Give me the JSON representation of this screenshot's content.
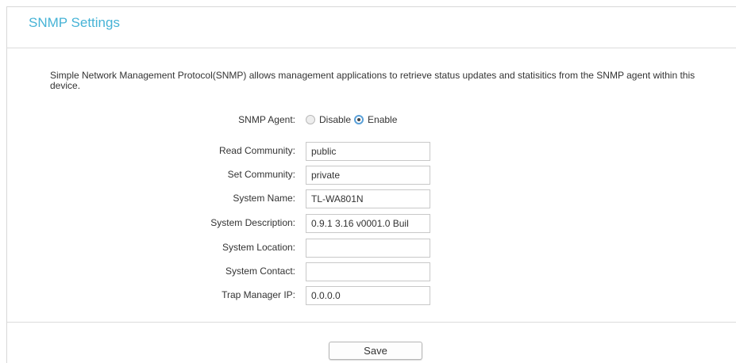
{
  "page": {
    "title": "SNMP Settings",
    "description": "Simple Network Management Protocol(SNMP) allows management applications to retrieve status updates and statisitics from the SNMP agent within this device."
  },
  "snmp_agent": {
    "label": "SNMP Agent:",
    "options": [
      {
        "label": "Disable",
        "checked": false
      },
      {
        "label": "Enable",
        "checked": true
      }
    ]
  },
  "fields": {
    "read_community": {
      "label": "Read Community:",
      "value": "public"
    },
    "set_community": {
      "label": "Set Community:",
      "value": "private"
    },
    "system_name": {
      "label": "System Name:",
      "value": "TL-WA801N"
    },
    "system_description": {
      "label": "System Description:",
      "value": "0.9.1 3.16 v0001.0 Buil"
    },
    "system_location": {
      "label": "System Location:",
      "value": ""
    },
    "system_contact": {
      "label": "System Contact:",
      "value": ""
    },
    "trap_manager_ip": {
      "label": "Trap Manager IP:",
      "value": "0.0.0.0"
    }
  },
  "actions": {
    "save_label": "Save"
  },
  "colors": {
    "title": "#46b3d6",
    "radio_checked_border": "#5aa0d8"
  }
}
